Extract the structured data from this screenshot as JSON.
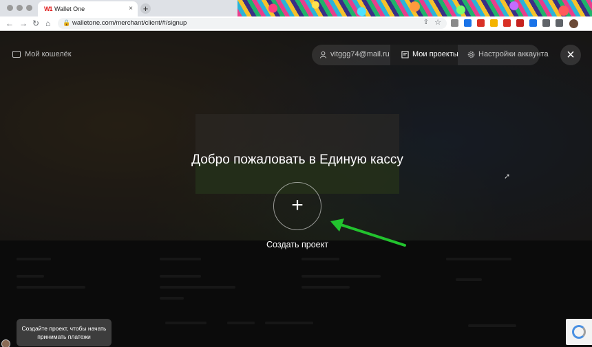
{
  "browser": {
    "tab_title": "Wallet One",
    "tab_favicon": "W1",
    "tab_close": "×",
    "new_tab": "+",
    "url": "walletone.com/merchant/client/#/signup",
    "nav_back": "←",
    "nav_forward": "→",
    "nav_reload": "↻",
    "nav_home": "⌂",
    "share_glyph": "⇪",
    "star_glyph": "☆",
    "extension_colors": [
      "#8a8a8a",
      "#1a73e8",
      "#d93025",
      "#f4b400",
      "#d93025",
      "#c5221f",
      "#1a73e8",
      "#5f6368",
      "#5f6368"
    ]
  },
  "header": {
    "wallet_link": "Мой кошелёк",
    "user_email": "vitggg74@mail.ru",
    "projects": "Мои проекты",
    "settings": "Настройки аккаунта",
    "close_glyph": "×"
  },
  "main": {
    "welcome": "Добро пожаловать в Единую кассу",
    "create_glyph": "+",
    "create_label": "Создать проект"
  },
  "tooltip": {
    "line1": "Создайте проект, чтобы начать",
    "line2": "принимать платежи"
  },
  "colors": {
    "arrow": "#22c32e",
    "overlay": "#000000"
  }
}
